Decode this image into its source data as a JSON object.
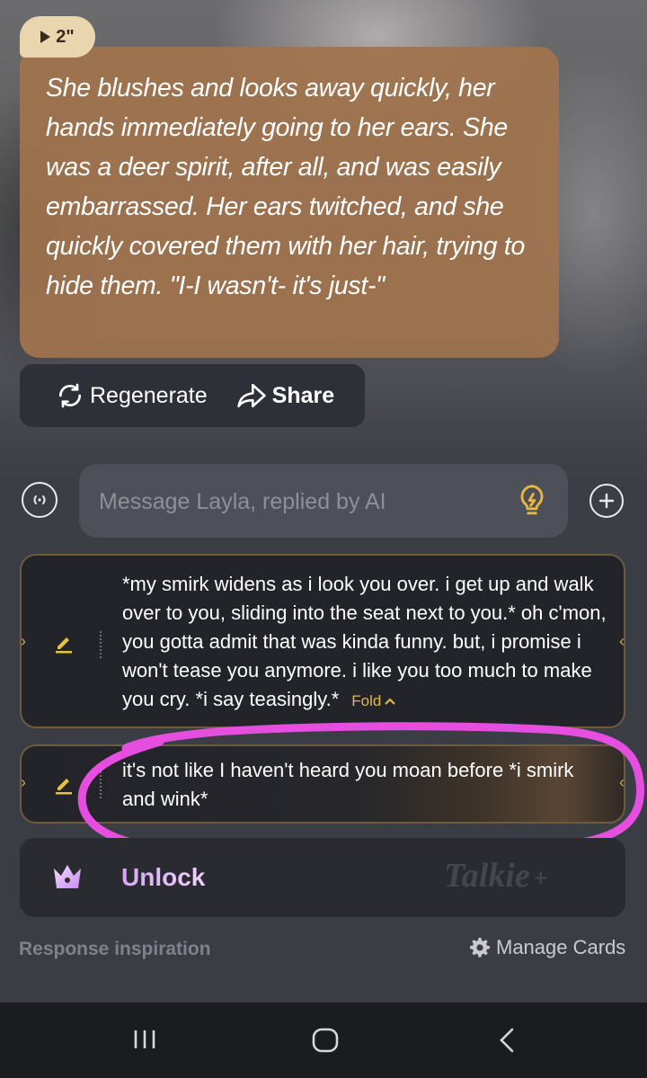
{
  "message": {
    "voice_duration": "2\"",
    "text": "She blushes and looks away quickly, her hands immediately going to her ears. She was a deer spirit, after all, and was easily embarrassed. Her ears twitched, and she quickly covered them with her hair, trying to hide them. \"I-I wasn't- it's just-\"",
    "colors": {
      "bubble": "#a0734e",
      "badge": "#e9d6ae"
    }
  },
  "actions": {
    "regenerate_label": "Regenerate",
    "share_label": "Share"
  },
  "composer": {
    "placeholder": "Message Layla, replied by AI",
    "voice_icon": "voice-wave-icon",
    "hint_icon": "lightbulb-icon",
    "add_icon": "plus-circle-icon"
  },
  "replies": [
    {
      "text": "*my smirk widens as i look you over. i get up and walk over to you, sliding into the seat next to you.* oh c'mon, you gotta admit that was kinda funny. but, i promise i won't tease you anymore. i like you too much to make you cry. *i say teasingly.*",
      "fold_label": "Fold"
    },
    {
      "text": "it's not like I haven't heard you moan before *i smirk and wink*"
    }
  ],
  "unlock": {
    "label": "Unlock",
    "watermark": "Talkie"
  },
  "footer": {
    "response_inspiration": "Response inspiration",
    "manage_cards": "Manage Cards"
  },
  "accent_colors": {
    "highlight": "#e64ee0",
    "gold": "#e0b84a"
  }
}
